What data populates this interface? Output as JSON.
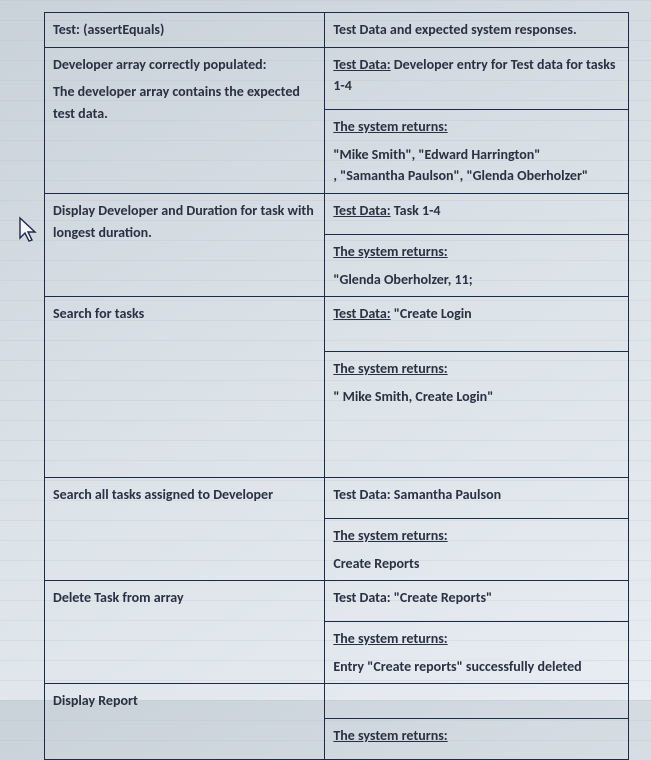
{
  "header": {
    "leftTitle": "Test: (assertEquals)",
    "rightTitle": "Test Data and expected system responses."
  },
  "rows": [
    {
      "left": {
        "title": "Developer array correctly populated:",
        "body": "The developer array contains the expected test data."
      },
      "rightCells": [
        {
          "label": "Test Data:",
          "tail": " Developer entry for Test data for tasks 1-4"
        },
        {
          "label": "The system returns:",
          "lines": [
            "\"Mike Smith\", \"Edward Harrington\"",
            ", \"Samantha Paulson\", \"Glenda Oberholzer\""
          ]
        }
      ]
    },
    {
      "left": {
        "title": "Display Developer and Duration for task with longest duration."
      },
      "rightCells": [
        {
          "label": "Test Data:",
          "tail": " Task 1-4"
        },
        {
          "label": "The system returns:",
          "lines": [
            "\"Glenda Oberholzer, 11;"
          ]
        }
      ]
    },
    {
      "left": {
        "title": "Search for tasks"
      },
      "rightCells": [
        {
          "label": "Test Data:",
          "tail": " \"Create Login",
          "gapAfter": true
        },
        {
          "label": "The system returns:",
          "lines": [
            "\" Mike Smith, Create Login\""
          ],
          "bigGapAfter": true
        }
      ]
    },
    {
      "left": {
        "title": "Search all tasks assigned to Developer"
      },
      "rightCells": [
        {
          "plainLabel": "Test Data:",
          "tail": " Samantha Paulson"
        },
        {
          "label": "The system returns:",
          "lines": [
            "Create Reports"
          ]
        }
      ]
    },
    {
      "left": {
        "title": "Delete Task from array"
      },
      "rightCells": [
        {
          "plainLabel": "Test Data:",
          "tail": " \"Create Reports\""
        },
        {
          "label": "The system returns:",
          "lines": [
            "Entry \"Create reports\" successfully deleted"
          ]
        }
      ]
    },
    {
      "left": {
        "title": "Display Report"
      },
      "rightCells": [
        {
          "empty": true
        },
        {
          "label": "The system returns:"
        }
      ]
    }
  ]
}
